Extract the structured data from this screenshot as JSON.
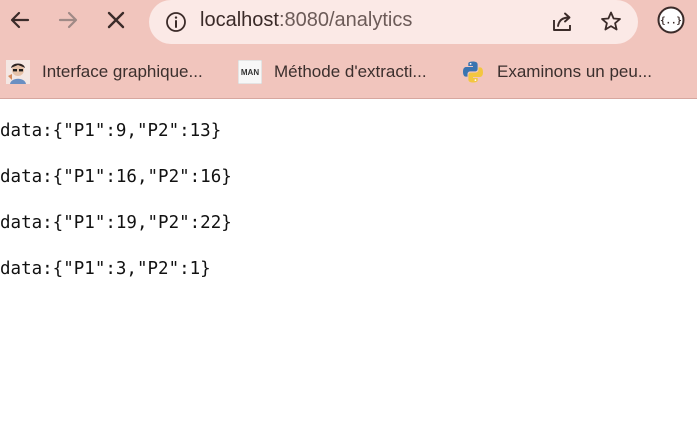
{
  "browser": {
    "url_host": "localhost",
    "url_rest": ":8080/analytics",
    "bookmarks": [
      {
        "label": "Interface graphique...",
        "icon": "avatar-favicon-icon"
      },
      {
        "label": "Méthode d'extracti...",
        "icon": "man-favicon-icon",
        "icon_text": "MAN"
      },
      {
        "label": "Examinons un peu...",
        "icon": "python-favicon-icon"
      }
    ]
  },
  "page": {
    "lines": [
      "data:{\"P1\":9,\"P2\":13}",
      "data:{\"P1\":16,\"P2\":16}",
      "data:{\"P1\":19,\"P2\":22}",
      "data:{\"P1\":3,\"P2\":1}"
    ]
  }
}
